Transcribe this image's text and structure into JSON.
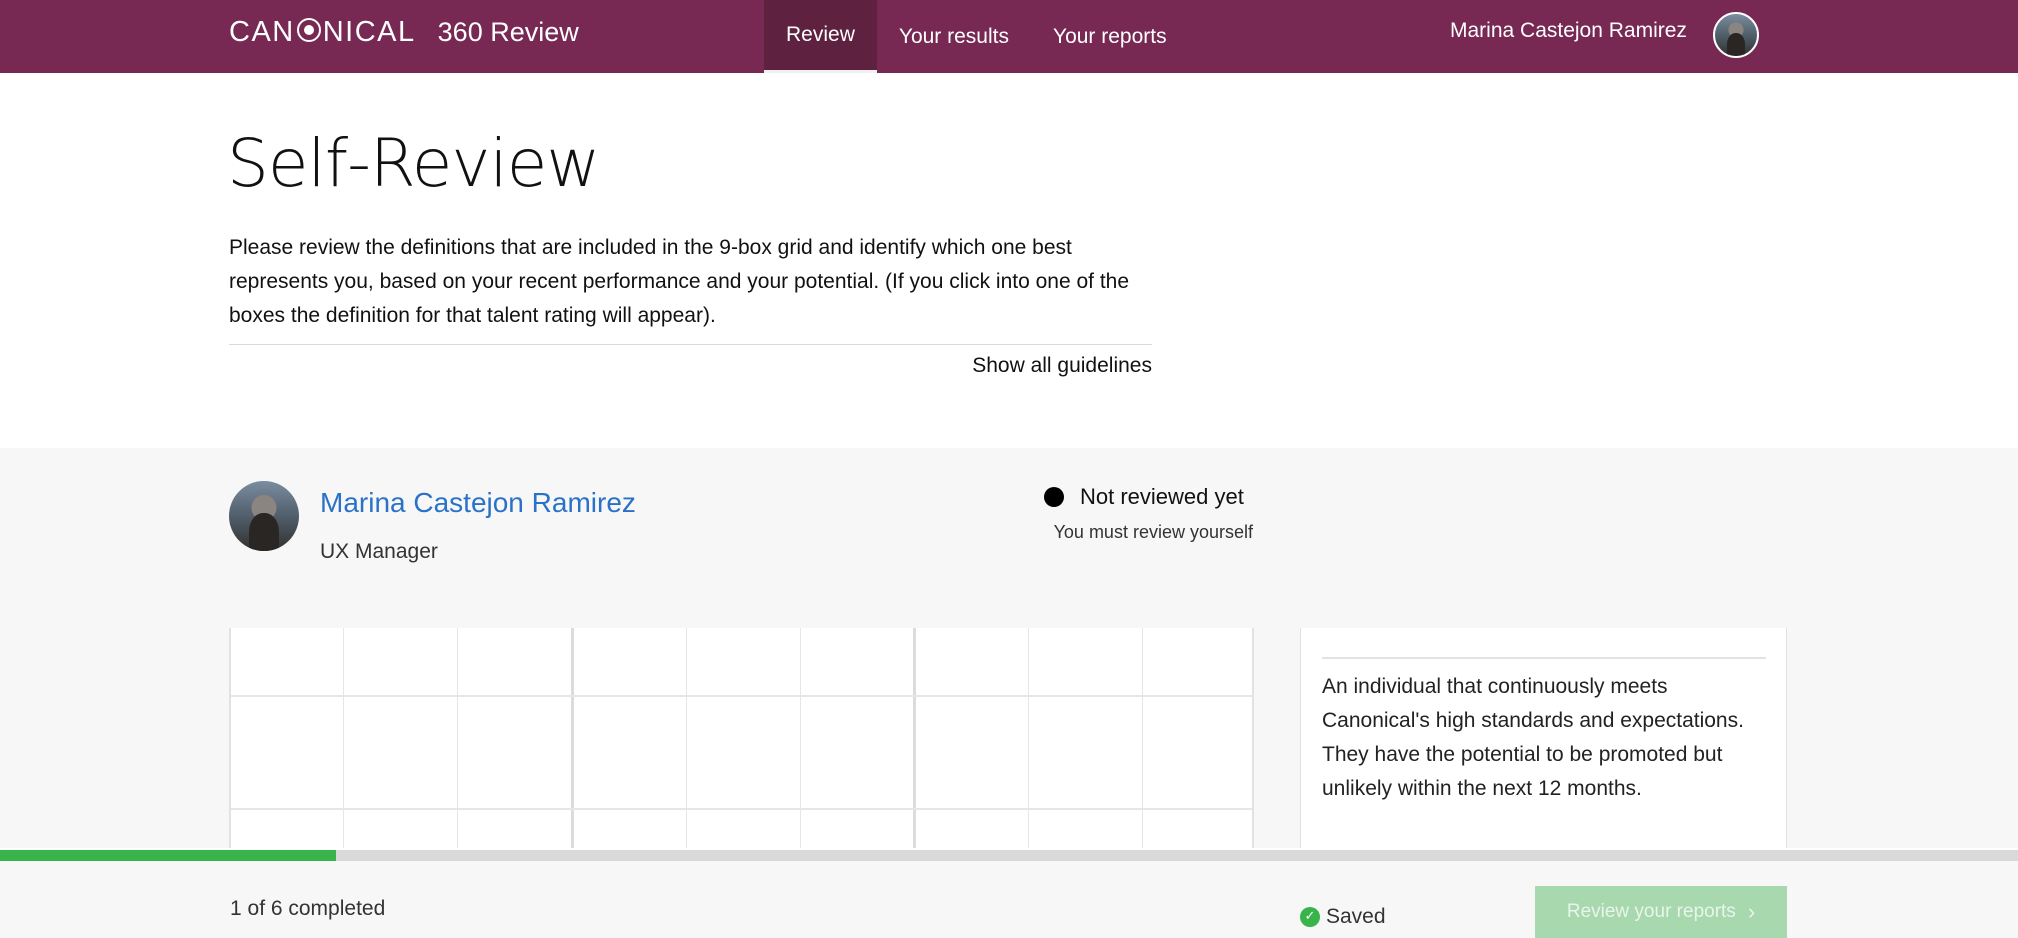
{
  "header": {
    "logo_text": "CANONICAL",
    "app_name": "360 Review",
    "nav": [
      {
        "label": "Review",
        "active": true
      },
      {
        "label": "Your results",
        "active": false
      },
      {
        "label": "Your reports",
        "active": false
      }
    ],
    "user_name": "Marina Castejon Ramirez"
  },
  "page": {
    "title": "Self-Review",
    "intro": "Please review the definitions that are included in the 9-box grid and identify which one best represents you, based on your recent performance and your potential. (If you click into one of the boxes the definition for that talent rating will appear).",
    "guidelines_link": "Show all guidelines"
  },
  "review": {
    "person_name": "Marina Castejon Ramirez",
    "role": "UX Manager",
    "status": "Not reviewed yet",
    "status_sub": "You must review yourself",
    "definition": "An individual that continuously meets Canonical's high standards and expectations. They have the potential to be promoted but unlikely within the next 12 months."
  },
  "footer": {
    "progress_fraction": 0.1667,
    "completed_text": "1 of 6 completed",
    "saved_text": "Saved",
    "button_label": "Review your reports"
  },
  "colors": {
    "header_bg": "#772953",
    "link": "#2a72c8",
    "progress": "#38b44a",
    "button_disabled": "#a8d8ae"
  }
}
